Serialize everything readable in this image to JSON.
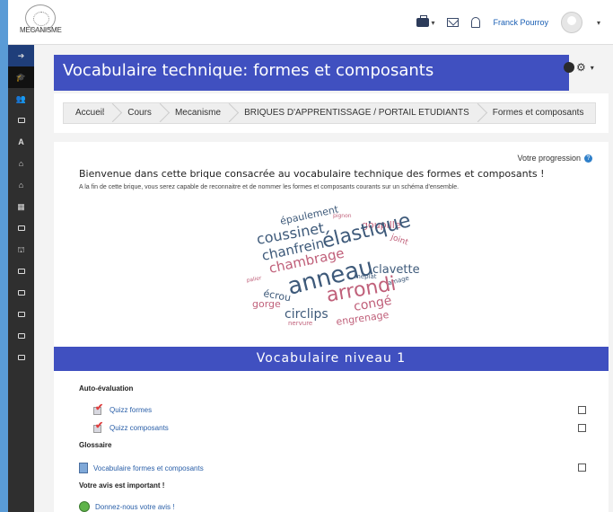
{
  "brand": {
    "name": "MECANISME"
  },
  "navbar": {
    "user_name": "Franck Pourroy",
    "caret": "▾"
  },
  "page": {
    "title": "Vocabulaire technique: formes et composants"
  },
  "breadcrumb": [
    "Accueil",
    "Cours",
    "Mecanisme",
    "BRIQUES D'APPRENTISSAGE / PORTAIL ETUDIANTS",
    "Formes et composants"
  ],
  "content": {
    "progress_label": "Votre progression",
    "help_glyph": "?",
    "welcome": "Bienvenue dans cette brique consacrée au vocabulaire technique des formes et composants !",
    "intro": "A la fin de cette brique, vous serez capable de reconnaitre et de nommer les formes et composants courants sur un schéma d'ensemble."
  },
  "wordcloud": {
    "words": [
      "épaulement",
      "pignon",
      "goupille",
      "coussinet",
      "élastique",
      "joint",
      "chanfrein",
      "chambrage",
      "clavette",
      "palier",
      "anneau",
      "méplat",
      "lamage",
      "écrou",
      "arrondi",
      "gorge",
      "congé",
      "circlips",
      "nervure",
      "engrenage"
    ]
  },
  "section": {
    "title": "Vocabulaire niveau 1",
    "labels": {
      "self_eval": "Auto-évaluation",
      "glossary": "Glossaire",
      "feedback": "Votre avis est important !"
    },
    "activities": {
      "quiz_forms": "Quizz formes",
      "quiz_components": "Quizz composants",
      "glossary_item": "Vocabulaire formes et composants",
      "feedback_item": "Donnez-nous votre avis !"
    }
  },
  "colors": {
    "primary": "#4050c0",
    "sidebar": "#2f2f2f",
    "link": "#2a5fa8",
    "wordcloud_dark": "#3e5a7a",
    "wordcloud_pink": "#c0607a"
  }
}
